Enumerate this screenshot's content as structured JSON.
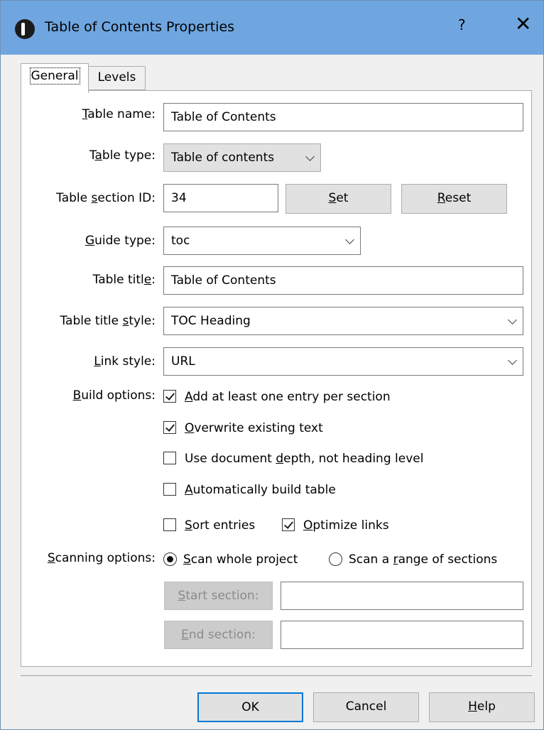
{
  "window": {
    "title": "Table of Contents Properties",
    "help_glyph": "?",
    "close_glyph": "✕"
  },
  "tabs": [
    {
      "label": "General"
    },
    {
      "label": "Levels"
    }
  ],
  "form": {
    "table_name": {
      "label": "Table name:",
      "value": "Table of Contents"
    },
    "table_type": {
      "label": "Table type:",
      "value": "Table of contents"
    },
    "table_section_id": {
      "label": "Table section ID:",
      "value": "34",
      "set_label": "Set",
      "reset_label": "Reset"
    },
    "guide_type": {
      "label": "Guide type:",
      "value": "toc"
    },
    "table_title": {
      "label": "Table title:",
      "value": "Table of Contents"
    },
    "table_title_style": {
      "label": "Table title style:",
      "value": "TOC Heading"
    },
    "link_style": {
      "label": "Link style:",
      "value": "URL"
    },
    "build_options": {
      "label": "Build options:",
      "items": [
        {
          "label": "Add at least one entry per section",
          "checked": true
        },
        {
          "label": "Overwrite existing text",
          "checked": true
        },
        {
          "label": "Use document depth, not heading level",
          "checked": false
        },
        {
          "label": "Automatically build table",
          "checked": false
        },
        {
          "label": "Sort entries",
          "checked": false
        },
        {
          "label": "Optimize links",
          "checked": true
        }
      ]
    },
    "scanning_options": {
      "label": "Scanning options:",
      "options": [
        {
          "label": "Scan whole project",
          "selected": true
        },
        {
          "label": "Scan a range of sections",
          "selected": false
        }
      ],
      "start_section": {
        "button": "Start section:",
        "value": ""
      },
      "end_section": {
        "button": "End section:",
        "value": ""
      }
    }
  },
  "footer": {
    "ok": "OK",
    "cancel": "Cancel",
    "help": "Help"
  },
  "colors": {
    "titlebar": "#6fa6e0",
    "focus": "#0078d7"
  }
}
